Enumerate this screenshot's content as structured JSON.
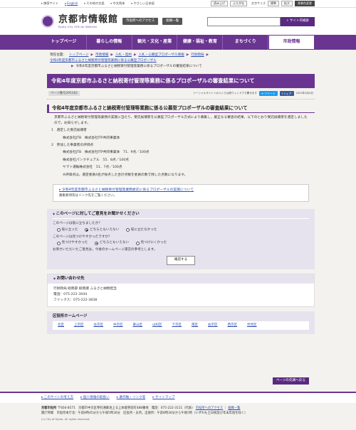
{
  "utility": {
    "links": [
      "携帯サイト",
      "English",
      "その他の言語",
      "中文简体",
      "やさしい日本語"
    ],
    "read_aloud": "読み上げ",
    "furigana": "ふりがな",
    "text_size_label": "文字サイズ",
    "size_standard": "標準",
    "size_large": "拡大",
    "color_label": "背景色変更"
  },
  "header": {
    "site_name": "京都市情報館",
    "site_name_en": "Kyoto City Official Website",
    "access_btn": "市役所へのアクセス",
    "org_btn": "組織一覧",
    "search_placeholder": "",
    "search_btn": "サイト内検索"
  },
  "nav": [
    "トップページ",
    "暮らしの情報",
    "観光・文化・産業",
    "健康・福祉・教育",
    "まちづくり",
    "市政情報"
  ],
  "breadcrumb": {
    "label": "現在位置：",
    "items": [
      "トップページ",
      "市政情報",
      "入札・契約",
      "入札・公募型プロポーザル情報",
      "行財政局",
      "令和4年度京都市ふるさと納税寄付管理等業務に係る公募型プロポーザル"
    ],
    "current": "令和4年度京都市ふるさと納税寄付管理等業務に係るプロポーザルの審査結果について"
  },
  "article": {
    "title": "令和4年度京都市ふるさと納税寄付管理等業務に係るプロポーザルの審査結果について",
    "page_no": "ページ番号295182",
    "social_note": "ソーシャルサイトへのリンクは別ウィンドウで開きます",
    "tweet": "ツイート",
    "share": "シェア",
    "date": "2022年3月4日",
    "heading": "令和4年度京都市ふるさと納税寄付管理等業務に係る公募型プロポーザルの審査結果について",
    "intro": "京都市ふるさと納税寄付管理等業務の実施に当たり，受託候補者を公募型プロポーザル方式により募集し，厳正なる審査の結果，以下のとおり受託候補者を選定しましたので，お知らせします。",
    "sec1_title": "1　選定した受託候補者",
    "sec1_body": "株式会社JTB　株式会社ITP共同事業体",
    "sec2_title": "2　参加した事業者の評価点",
    "scores": [
      "株式会社JTB　株式会社ITP共同事業体　71．9点／100点",
      "株式会社パンクチュアル　55．8点／100点",
      "ヤマト運輸株式会社　51．7点／100点"
    ],
    "note": "※評価点は，選定委員4名が採点した合計点数を委員の数で除した点数になります。",
    "related_link": "令和4年度京都市ふるさと納税寄付管理等業務委託に係るプロポーザルの実施について",
    "related_sub": "募集要項等はリンク先をご覧ください。"
  },
  "feedback": {
    "heading": "このページに対してご意見をお聞かせください",
    "q1": "このページは役に立ちましたか？",
    "q1_options": [
      "役に立った",
      "どちらともいえない",
      "役に立たなかった"
    ],
    "q2": "このページは見つけやすかったですか？",
    "q2_options": [
      "見つけやすかった",
      "どちらともいえない",
      "見つけにくかった"
    ],
    "note": "お寄せいただいたご意見は，今後のホームページ運営の参考とします。",
    "submit": "確認する"
  },
  "contact": {
    "heading": "お問い合わせ先",
    "dept": "行財政局 総務部 総務課 ふるさと納税担当",
    "tel": "電話：075-222-3044",
    "fax": "ファックス：075-222-3838"
  },
  "wards": {
    "heading": "区役所ホームページ",
    "items": [
      "北区",
      "上京区",
      "左京区",
      "中京区",
      "東山区",
      "山科区",
      "下京区",
      "南区",
      "右京区",
      "西京区",
      "伏見区"
    ]
  },
  "page_top": "ページの先頭へ戻る",
  "footer": {
    "links": [
      "このサイトの考え方",
      "個人情報の取扱い",
      "著作権・リンク等",
      "サイトマップ"
    ],
    "city": "京都市役所",
    "address": "〒604-8571　京都市中京区寺町通御池上る上本能寺前町488番地　電話：075-222-3111（代表）",
    "access": "市役所へのアクセス",
    "org": "組織一覧",
    "hours": "開庁時間　市役所本庁舎：午前8時45分から午後5時30分　区役所・支所，出張所：午前8時30分から午後5時（いずれも土日祝及び年末年始を除く）",
    "copyright": "(c) City of Kyoto. All rights reserved."
  }
}
